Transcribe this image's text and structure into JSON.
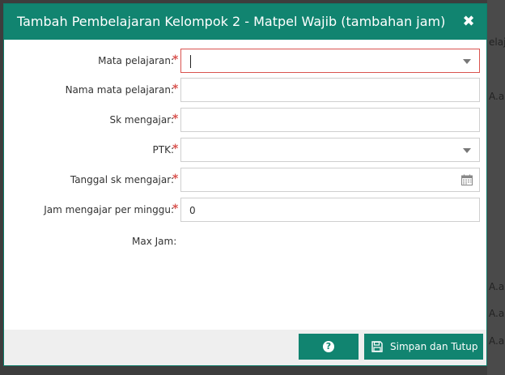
{
  "background": {
    "right_texts": [
      "elajaru",
      "A.an",
      "A.an",
      "A.an",
      "A.an"
    ]
  },
  "modal": {
    "title": "Tambah Pembelajaran Kelompok 2 - Matpel Wajib (tambahan jam)",
    "close_glyph": "✖"
  },
  "form": {
    "mata_pelajaran": {
      "label": "Mata pelajaran:",
      "value": ""
    },
    "nama_mata_pelajaran": {
      "label": "Nama mata pelajaran:",
      "value": ""
    },
    "sk_mengajar": {
      "label": "Sk mengajar:",
      "value": ""
    },
    "ptk": {
      "label": "PTK:",
      "value": ""
    },
    "tanggal_sk_mengajar": {
      "label": "Tanggal sk mengajar:",
      "value": ""
    },
    "jam_mengajar": {
      "label": "Jam mengajar per minggu:",
      "value": "0"
    },
    "max_jam": {
      "label": "Max Jam:"
    },
    "required_mark": "*"
  },
  "footer": {
    "help_glyph": "?",
    "save_label": "Simpan dan Tutup"
  },
  "colors": {
    "header": "#118470",
    "required": "#d9534f"
  }
}
